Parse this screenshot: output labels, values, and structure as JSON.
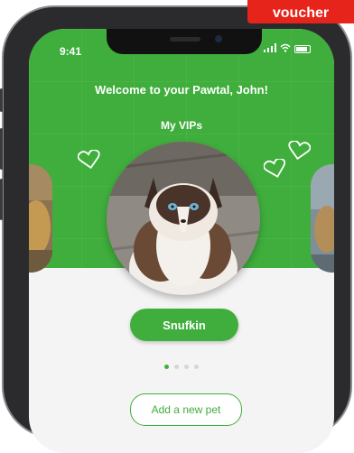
{
  "status_bar": {
    "time": "9:41"
  },
  "header": {
    "welcome": "Welcome to your Pawtal, John!",
    "section": "My VIPs"
  },
  "pets": {
    "current_name": "Snufkin",
    "page_count": 4,
    "active_index": 0
  },
  "actions": {
    "add_pet": "Add a new pet"
  },
  "banner": {
    "voucher": "voucher"
  },
  "icons": {
    "heart": "heart-outline-icon",
    "wifi": "wifi-icon",
    "battery": "battery-icon",
    "signal": "signal-icon"
  },
  "colors": {
    "brand_green": "#3fae3c",
    "banner_red": "#e6241b"
  }
}
